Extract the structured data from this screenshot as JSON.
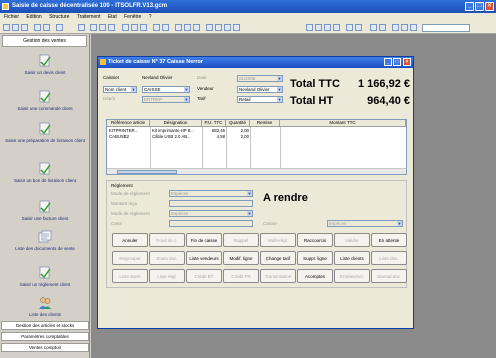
{
  "window": {
    "title": "Saisie de caisse décentralisée 100 - ITSOLFR.V13.gcm"
  },
  "menu": [
    "Fichier",
    "Edition",
    "Structure",
    "Traitement",
    "Etat",
    "Fenêtre",
    "?"
  ],
  "sidebar": {
    "header": "Gestion des ventes",
    "items": [
      {
        "label": "Saisir un devis client"
      },
      {
        "label": "Saisir une commande client"
      },
      {
        "label": "Saisir une préparation de livraison client"
      },
      {
        "label": "Saisir un bon de livraison client"
      },
      {
        "label": "Saisir une facture client"
      },
      {
        "label": "Liste des documents de vente"
      },
      {
        "label": "Saisir un règlement client"
      },
      {
        "label": "Liste des clients"
      }
    ],
    "footer": [
      "Gestion des articles et stocks",
      "Paramètres comptables",
      "Ventes comptoir"
    ]
  },
  "dialog": {
    "title": "Ticket de caisse N° 37 Caisse Nerror",
    "caissier_label": "Caissier",
    "caissier_value": "Nevland Olivier",
    "client_value": "Nom client",
    "caisse_value": "CAISSE",
    "depot_label": "Dépôt",
    "depot_value": "ENTREP",
    "date_label": "Date",
    "date_value": "01/2006",
    "vendeur_label": "Vendeur",
    "vendeur_value": "Nevland Olivier",
    "tarif_label": "Tarif",
    "tarif_value": "Retail",
    "total_ttc_label": "Total TTC",
    "total_ttc_value": "1 166,92 €",
    "total_ht_label": "Total HT",
    "total_ht_value": "964,40 €",
    "columns": [
      "Référence article",
      "Désignation",
      "P.U. TTC",
      "Quantité",
      "Remise",
      "Montant TTC"
    ],
    "rows": [
      [
        "KITPRINTER...",
        "Kit imprimante HP 8...",
        "583,46",
        "2,00",
        "",
        ""
      ],
      [
        "CABUSB2",
        "Câble USB 2.0 AB...",
        "4,58",
        "2,00",
        "",
        ""
      ]
    ],
    "reglement": {
      "label": "Règlement",
      "mode_label": "Mode de règlement",
      "mode_value": "Espèces",
      "montant_label": "Montant reçu",
      "mode2_label": "Mode de règlement",
      "mode2_value": "Espèces",
      "carte_label": "Carte",
      "a_rendre": "A rendre",
      "caisse_label": "Caisse",
      "caisse_value": "Espèces"
    },
    "buttons": [
      {
        "label": "Annuler",
        "enabled": true
      },
      {
        "label": "Fond de c.",
        "enabled": false
      },
      {
        "label": "Fin de caisse",
        "enabled": true
      },
      {
        "label": "Rappel",
        "enabled": false
      },
      {
        "label": "Multi-règl.",
        "enabled": false
      },
      {
        "label": "Raccourcis",
        "enabled": true
      },
      {
        "label": "Valider",
        "enabled": false
      },
      {
        "label": "En attente",
        "enabled": true
      },
      {
        "label": "Regrouper",
        "enabled": false
      },
      {
        "label": "Zoom doc.",
        "enabled": false
      },
      {
        "label": "Liste vendeurs",
        "enabled": true
      },
      {
        "label": "Modif. ligne",
        "enabled": true
      },
      {
        "label": "Change tarif",
        "enabled": true
      },
      {
        "label": "Suppr. ligne",
        "enabled": true
      },
      {
        "label": "Liste clients",
        "enabled": true
      },
      {
        "label": "Liste doc.",
        "enabled": false
      },
      {
        "label": "Liste stock",
        "enabled": false
      },
      {
        "label": "Liste régl.",
        "enabled": false
      },
      {
        "label": "Crédit BT",
        "enabled": false
      },
      {
        "label": "Crédit FR",
        "enabled": false
      },
      {
        "label": "Transmission",
        "enabled": false
      },
      {
        "label": "Acomptes",
        "enabled": true
      },
      {
        "label": "Entrées/sor.",
        "enabled": false
      },
      {
        "label": "Journal doc.",
        "enabled": false
      }
    ]
  }
}
